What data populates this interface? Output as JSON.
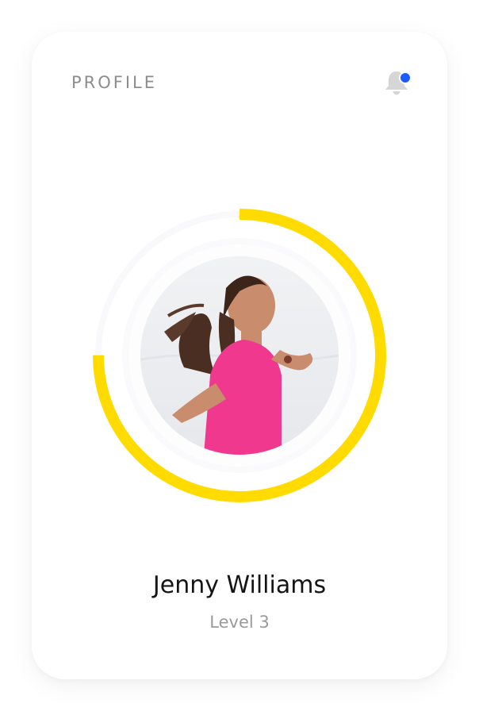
{
  "header": {
    "title": "PROFILE",
    "notification_icon": "bell-icon",
    "has_unread": true
  },
  "profile": {
    "name": "Jenny Williams",
    "level": "Level 3",
    "avatar_icon": "profile-photo",
    "progress_fraction": 0.75
  },
  "colors": {
    "accent": "#FFDB00",
    "notification_dot": "#1A5CFF",
    "track": "#F7F7F9"
  }
}
